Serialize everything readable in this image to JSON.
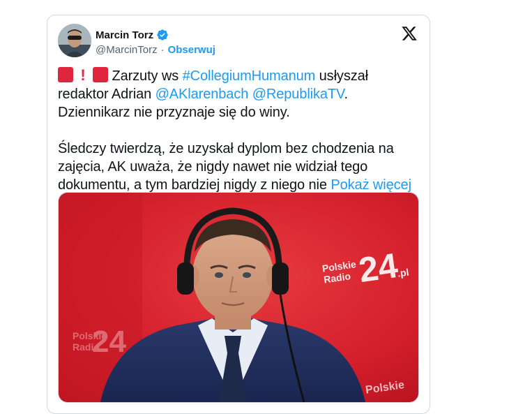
{
  "tweet": {
    "author_name": "Marcin Torz",
    "author_handle": "@MarcinTorz",
    "separator": "·",
    "follow_label": "Obserwuj",
    "text_1_after_emoji": " Zarzuty ws ",
    "hashtag": "#CollegiumHumanum",
    "text_1_mid": " usłyszał redaktor Adrian ",
    "mention_1": "@AKlarenbach",
    "text_1_space": " ",
    "mention_2": "@RepublikaTV",
    "text_1_end": ". Dziennikarz nie przyznaje się do winy.",
    "paragraph_2": "Śledczy twierdzą, że uzyskał dyplom bez chodzenia na zajęcia, AK uważa, że nigdy nawet nie widział tego dokumentu, a tym bardziej nigdy z niego nie ",
    "show_more": "Pokaż więcej",
    "exclamation": "!"
  },
  "photo": {
    "logo_line1": "Polskie",
    "logo_line2": "Radio",
    "logo_number": "24",
    "logo_suffix": ".pl"
  },
  "colors": {
    "accent": "#1d9bf0",
    "emoji_red": "#e0263f",
    "studio_red": "#d41f2c"
  }
}
